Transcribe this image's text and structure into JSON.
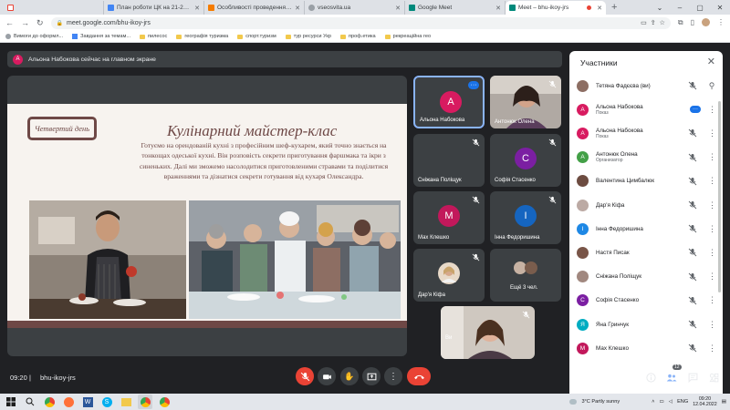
{
  "browser": {
    "tabs": [
      {
        "title": "План роботи ЦК на 21-22н.р.",
        "color": "#34a853",
        "fav": "M"
      },
      {
        "title": "Особливості проведення екск...",
        "color": "#4285f4",
        "fav": "E"
      },
      {
        "title": "Особливості проведення екск...",
        "color": "#fbbc04",
        "fav": "B"
      },
      {
        "title": "vseosvita.ua",
        "color": "#9aa0a6",
        "fav": ""
      },
      {
        "title": "Google Meet",
        "color": "#00897b",
        "fav": ""
      },
      {
        "title": "Meet – bhu-ikoy-jrs",
        "color": "#00897b",
        "fav": ""
      }
    ],
    "url": "meet.google.com/bhu-ikoy-jrs",
    "bookmarks": [
      "Вимоги до оформл...",
      "Завдання за темам...",
      "пилесос",
      "географія туризма",
      "спорт.туризм",
      "тур ресурси Укр",
      "проф.етика",
      "рекреаційна гео"
    ]
  },
  "meet": {
    "banner": "Альона Набокова сейчас на главном экране",
    "banner_avatar": "А",
    "slide": {
      "day": "Четвертий день",
      "title": "Кулінарний майстер-клас",
      "body": "Готуємо на орендованій кухні з професійним шеф-кухарем, який точно знається на тонкощах одеської кухні. Він розповість секрети приготування фаршмака та ікри з синеньких. Далі ми зможемо насолодитися приготовленими стравами та поділитися враженнями та дізнатися секрети готування від кухаря Олександра."
    },
    "tiles": [
      {
        "name": "Альона Набокова",
        "initial": "А",
        "color": "#d81b60",
        "type": "avatar"
      },
      {
        "name": "Антонюк Олена",
        "initial": "",
        "color": "#a9a9a9",
        "type": "video"
      },
      {
        "name": "Сніжана Поліщук",
        "initial": "",
        "color": "#888",
        "type": "empty"
      },
      {
        "name": "Софія Стасенко",
        "initial": "С",
        "color": "#7b1fa2",
        "type": "avatar"
      },
      {
        "name": "Мах Клешко",
        "initial": "М",
        "color": "#c2185b",
        "type": "avatar"
      },
      {
        "name": "Інна Федоришина",
        "initial": "І",
        "color": "#1565c0",
        "type": "avatar"
      },
      {
        "name": "Дар'я Кіфа",
        "initial": "",
        "color": "#d7ccc8",
        "type": "photo"
      },
      {
        "name": "Ещё 3 чел.",
        "initial": "",
        "color": "",
        "type": "more"
      }
    ],
    "self_tile_name": "Ви",
    "time": "09:20",
    "meeting_code": "bhu-ikoy-jrs",
    "people_badge": "12"
  },
  "participants": {
    "header": "Участники",
    "list": [
      {
        "name": "Тетяна Фадєєва (ви)",
        "role": "",
        "color": "#8d6e63",
        "initial": "",
        "muted": true,
        "pin": true
      },
      {
        "name": "Альона Набокова",
        "role": "Показ",
        "color": "#d81b60",
        "initial": "А",
        "muted": false,
        "pin": false
      },
      {
        "name": "Альона Набокова",
        "role": "Показ",
        "color": "#d81b60",
        "initial": "А",
        "muted": true,
        "pin": false
      },
      {
        "name": "Антонюк Олена",
        "role": "Организатор",
        "color": "#43a047",
        "initial": "А",
        "muted": true,
        "pin": false
      },
      {
        "name": "Валентина Цимбалюк",
        "role": "",
        "color": "#6d4c41",
        "initial": "",
        "muted": true,
        "pin": false
      },
      {
        "name": "Дар'я Кіфа",
        "role": "",
        "color": "#bcaaa4",
        "initial": "",
        "muted": true,
        "pin": false
      },
      {
        "name": "Інна Федоришина",
        "role": "",
        "color": "#1e88e5",
        "initial": "І",
        "muted": true,
        "pin": false
      },
      {
        "name": "Настя Писак",
        "role": "",
        "color": "#795548",
        "initial": "",
        "muted": true,
        "pin": false
      },
      {
        "name": "Сніжана Поліщук",
        "role": "",
        "color": "#a1887f",
        "initial": "",
        "muted": true,
        "pin": false
      },
      {
        "name": "Софія Стасенко",
        "role": "",
        "color": "#7b1fa2",
        "initial": "С",
        "muted": true,
        "pin": false
      },
      {
        "name": "Яна Гринчук",
        "role": "",
        "color": "#00acc1",
        "initial": "Я",
        "muted": true,
        "pin": false
      },
      {
        "name": "Мах Клешко",
        "role": "",
        "color": "#c2185b",
        "initial": "М",
        "muted": true,
        "pin": false
      }
    ]
  },
  "taskbar": {
    "weather": "3°C  Partly sunny",
    "lang": "ENG",
    "clock_time": "09:20",
    "clock_date": "12.04.2022"
  }
}
